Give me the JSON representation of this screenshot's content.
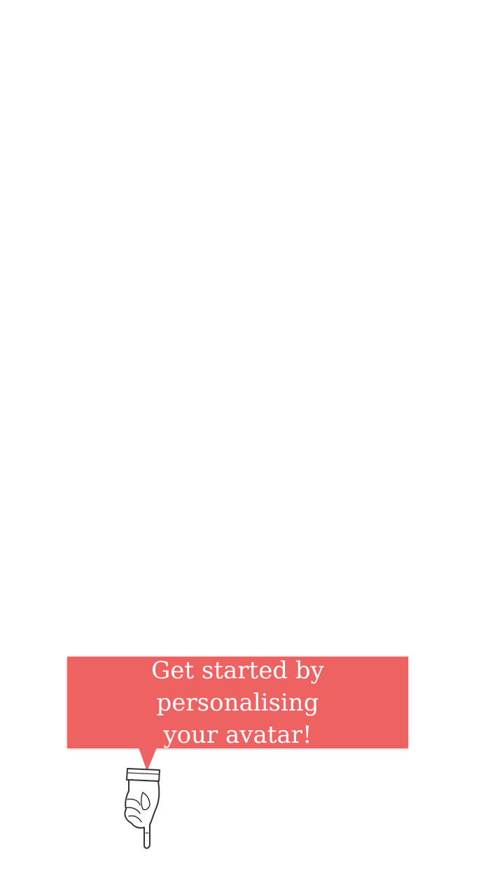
{
  "tooltip": {
    "message": "Get started by personalising\nyour avatar!",
    "background_color": "#ef6262",
    "text_color": "#ffffff"
  },
  "pointer": {
    "icon": "pointing-hand-icon",
    "direction": "down"
  }
}
